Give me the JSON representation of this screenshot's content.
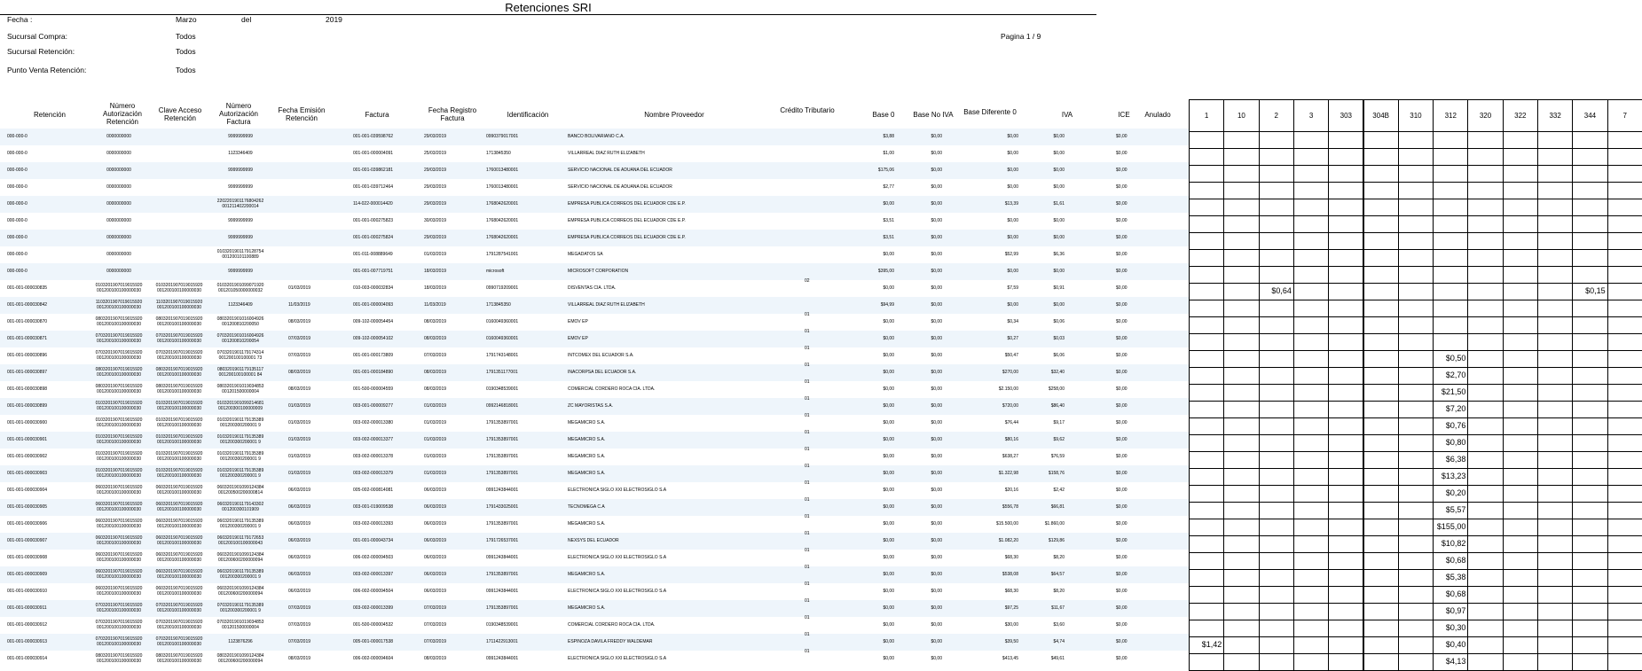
{
  "title": "Retenciones SRI",
  "page": "Pagina 1 / 9",
  "filters": [
    {
      "label": "Fecha :",
      "value": "Marzo",
      "extra1": "del",
      "extra2": "2019"
    },
    {
      "label": "Sucursal Compra:",
      "value": "Todos"
    },
    {
      "label": "Sucursal Retención:",
      "value": "Todos"
    },
    {
      "label": "Punto Venta Retención:",
      "value": "Todos"
    }
  ],
  "columns": {
    "retencion": "Retención",
    "num_aut_ret": "Número\nAutorización\nRetención",
    "clave": "Clave Acceso\nRetención",
    "num_aut_fac": "Número\nAutorización\nFactura",
    "fecha_emision": "Fecha Emisión\nRetención",
    "factura": "Factura",
    "fecha_registro": "Fecha Registro\nFactura",
    "identificacion": "Identificación",
    "proveedor": "Nombre Proveedor",
    "credito": "Crédito Tributario",
    "base0": "Base 0",
    "base_no_iva": "Base No IVA",
    "base_dif": "Base Diferente 0",
    "iva": "IVA",
    "ice": "ICE",
    "anulado": "Anulado"
  },
  "code_columns": [
    "1",
    "10",
    "2",
    "3",
    "303",
    "304B",
    "310",
    "312",
    "320",
    "322",
    "332",
    "344",
    "7"
  ],
  "rows": [
    {
      "ret": "000-000-0",
      "nar": "0000000000",
      "clave": "",
      "naf": "9999999999",
      "fe": "",
      "fac": "001-001-039598762",
      "fr": "29/03/2019",
      "id": "0990379017001",
      "prov": "BANCO BOLIVARIANO C.A.",
      "cred": "",
      "b0": "$3,88",
      "bni": "$0,00",
      "bd": "$0,00",
      "iva": "$0,00",
      "ice": "$0,00",
      "codes": {}
    },
    {
      "ret": "000-000-0",
      "nar": "0000000000",
      "clave": "",
      "naf": "1123346409",
      "fe": "",
      "fac": "001-001-000004091",
      "fr": "25/03/2019",
      "id": "1713845350",
      "prov": "VILLARREAL DIAZ RUTH ELIZABETH",
      "cred": "",
      "b0": "$1,00",
      "bni": "$0,00",
      "bd": "$0,00",
      "iva": "$0,00",
      "ice": "$0,00",
      "codes": {}
    },
    {
      "ret": "000-000-0",
      "nar": "0000000000",
      "clave": "",
      "naf": "9999999999",
      "fe": "",
      "fac": "001-001-039862181",
      "fr": "29/03/2019",
      "id": "1760013480001",
      "prov": "SERVICIO NACIONAL DE ADUANA DEL ECUADOR",
      "cred": "",
      "b0": "$175,06",
      "bni": "$0,00",
      "bd": "$0,00",
      "iva": "$0,00",
      "ice": "$0,00",
      "codes": {}
    },
    {
      "ret": "000-000-0",
      "nar": "0000000000",
      "clave": "",
      "naf": "9999999999",
      "fe": "",
      "fac": "001-001-039712464",
      "fr": "29/03/2019",
      "id": "1760013480001",
      "prov": "SERVICIO NACIONAL DE ADUANA DEL ECUADOR",
      "cred": "",
      "b0": "$2,77",
      "bni": "$0,00",
      "bd": "$0,00",
      "iva": "$0,00",
      "ice": "$0,00",
      "codes": {}
    },
    {
      "ret": "000-000-0",
      "nar": "0000000000",
      "clave": "",
      "naf": "2202201901176804262\n001211402200014",
      "fe": "",
      "fac": "114-022-000014420",
      "fr": "29/03/2019",
      "id": "1768042620001",
      "prov": "EMPRESA PUBLICA CORREOS DEL ECUADOR CDE E.P.",
      "cred": "",
      "b0": "$0,00",
      "bni": "$0,00",
      "bd": "$13,39",
      "iva": "$1,61",
      "ice": "$0,00",
      "codes": {}
    },
    {
      "ret": "000-000-0",
      "nar": "0000000000",
      "clave": "",
      "naf": "9999999999",
      "fe": "",
      "fac": "001-001-000275823",
      "fr": "30/03/2019",
      "id": "1768042620001",
      "prov": "EMPRESA PUBLICA CORREOS DEL ECUADOR CDE E.P.",
      "cred": "",
      "b0": "$3,51",
      "bni": "$0,00",
      "bd": "$0,00",
      "iva": "$0,00",
      "ice": "$0,00",
      "codes": {}
    },
    {
      "ret": "000-000-0",
      "nar": "0000000000",
      "clave": "",
      "naf": "9999999999",
      "fe": "",
      "fac": "001-001-000275824",
      "fr": "29/03/2019",
      "id": "1768042620001",
      "prov": "EMPRESA PUBLICA CORREOS DEL ECUADOR CDE E.P.",
      "cred": "",
      "b0": "$3,51",
      "bni": "$0,00",
      "bd": "$0,00",
      "iva": "$0,00",
      "ice": "$0,00",
      "codes": {}
    },
    {
      "ret": "000-000-0",
      "nar": "0000000000",
      "clave": "",
      "naf": "0103201901179128754\n001200101100889",
      "fe": "",
      "fac": "001-011-008889649",
      "fr": "01/03/2019",
      "id": "1791287541001",
      "prov": "MEGADATOS SA",
      "cred": "",
      "b0": "$0,00",
      "bni": "$0,00",
      "bd": "$52,99",
      "iva": "$6,36",
      "ice": "$0,00",
      "codes": {}
    },
    {
      "ret": "000-000-0",
      "nar": "0000000000",
      "clave": "",
      "naf": "9999999999",
      "fe": "",
      "fac": "001-001-007719751",
      "fr": "18/03/2019",
      "id": "microsoft",
      "prov": "MICROSOFT CORPORATION",
      "cred": "",
      "b0": "$395,00",
      "bni": "$0,00",
      "bd": "$0,00",
      "iva": "$0,00",
      "ice": "$0,00",
      "codes": {}
    },
    {
      "ret": "001-001-000030835",
      "nar": "0103201907019015920\n001200100100000030",
      "clave": "0103201907019015920\n001200100100000030",
      "naf": "0103201901099071920\n001201050000000032",
      "fe": "01/03/2019",
      "fac": "010-003-000032834",
      "fr": "18/03/2019",
      "id": "0990719209001",
      "prov": "DISVENTAS CIA. LTDA.",
      "cred": "02",
      "b0": "$0,00",
      "bni": "$0,00",
      "bd": "$7,59",
      "iva": "$0,91",
      "ice": "$0,00",
      "codes": {
        "2": "$0,64",
        "344": "$0,15"
      }
    },
    {
      "ret": "001-001-000030842",
      "nar": "1103201907019015920\n001200100100000030",
      "clave": "1103201907019015920\n001200100100000030",
      "naf": "1123346409",
      "fe": "11/03/2019",
      "fac": "001-001-000004093",
      "fr": "11/03/2019",
      "id": "1713845350",
      "prov": "VILLARREAL DIAZ RUTH ELIZABETH",
      "cred": "",
      "b0": "$94,99",
      "bni": "$0,00",
      "bd": "$0,00",
      "iva": "$0,00",
      "ice": "$0,00",
      "codes": {}
    },
    {
      "ret": "001-001-000030870",
      "nar": "0803201907019015920\n001200100100000030",
      "clave": "0803201907019015920\n001200100100000030",
      "naf": "0803201901016004926\n001200810200050",
      "fe": "08/03/2019",
      "fac": "009-102-000054454",
      "fr": "08/03/2019",
      "id": "0160049360001",
      "prov": "EMOV EP",
      "cred": "01",
      "b0": "$0,00",
      "bni": "$0,00",
      "bd": "$0,34",
      "iva": "$0,06",
      "ice": "$0,00",
      "codes": {}
    },
    {
      "ret": "001-001-000030871",
      "nar": "0703201907019015920\n001200100100000030",
      "clave": "0703201907019015920\n001200100100000030",
      "naf": "0703201901016004926\n001200810200054",
      "fe": "07/03/2019",
      "fac": "009-102-000054102",
      "fr": "08/03/2019",
      "id": "0160049360001",
      "prov": "EMOV EP",
      "cred": "01",
      "b0": "$0,00",
      "bni": "$0,00",
      "bd": "$0,27",
      "iva": "$0,03",
      "ice": "$0,00",
      "codes": {}
    },
    {
      "ret": "001-001-000030896",
      "nar": "0703201907019015920\n001200100100000030",
      "clave": "0703201907019015920\n001200100100000030",
      "naf": "0703201901179174314\n001200100100001 73",
      "fe": "07/03/2019",
      "fac": "001-001-000173809",
      "fr": "07/03/2019",
      "id": "1791743148001",
      "prov": "INTCOMEX DEL ECUADOR S.A.",
      "cred": "01",
      "b0": "$0,00",
      "bni": "$0,00",
      "bd": "$50,47",
      "iva": "$6,06",
      "ice": "$0,00",
      "codes": {
        "312": "$0,50"
      }
    },
    {
      "ret": "001-001-000030897",
      "nar": "0803201907019015920\n001200100100000030",
      "clave": "0803201907019015920\n001200100100000030",
      "naf": "0803201901179135117\n001200100100001 84",
      "fe": "08/03/2019",
      "fac": "001-001-000184890",
      "fr": "08/03/2019",
      "id": "1791351177001",
      "prov": "INACORPSA DEL ECUADOR S.A.",
      "cred": "01",
      "b0": "$0,00",
      "bni": "$0,00",
      "bd": "$270,00",
      "iva": "$32,40",
      "ice": "$0,00",
      "codes": {
        "312": "$2,70"
      }
    },
    {
      "ret": "001-001-000030898",
      "nar": "0803201907019015920\n001200100100000030",
      "clave": "0803201907019015920\n001200100100000030",
      "naf": "0803201901019034853\n001201500000004",
      "fe": "08/03/2019",
      "fac": "001-500-000004559",
      "fr": "08/03/2019",
      "id": "0190348539001",
      "prov": "COMERCIAL CORDERO ROCA CIA. LTDA.",
      "cred": "01",
      "b0": "$0,00",
      "bni": "$0,00",
      "bd": "$2.150,00",
      "iva": "$258,00",
      "ice": "$0,00",
      "codes": {
        "312": "$21,50"
      }
    },
    {
      "ret": "001-001-000030899",
      "nar": "0103201907019015920\n001200100100000030",
      "clave": "0103201907019015920\n001200100100000030",
      "naf": "0103201901099214681\n001200300100000009",
      "fe": "01/03/2019",
      "fac": "003-001-000009277",
      "fr": "01/03/2019",
      "id": "0992146818001",
      "prov": "ZC MAYORISTAS S.A.",
      "cred": "01",
      "b0": "$0,00",
      "bni": "$0,00",
      "bd": "$720,00",
      "iva": "$86,40",
      "ice": "$0,00",
      "codes": {
        "312": "$7,20"
      }
    },
    {
      "ret": "001-001-000030900",
      "nar": "0103201907019015920\n001200100100000030",
      "clave": "0103201907019015920\n001200100100000030",
      "naf": "0103201901179135389\n001200300200001 9",
      "fe": "01/03/2019",
      "fac": "003-002-000013380",
      "fr": "01/03/2019",
      "id": "1791353897001",
      "prov": "MEGAMICRO S.A.",
      "cred": "01",
      "b0": "$0,00",
      "bni": "$0,00",
      "bd": "$76,44",
      "iva": "$9,17",
      "ice": "$0,00",
      "codes": {
        "312": "$0,76"
      }
    },
    {
      "ret": "001-001-000030901",
      "nar": "0103201907019015920\n001200100100000030",
      "clave": "0103201907019015920\n001200100100000030",
      "naf": "0103201901179135389\n001200300200001 9",
      "fe": "01/03/2019",
      "fac": "003-002-000013377",
      "fr": "01/03/2019",
      "id": "1791353897001",
      "prov": "MEGAMICRO S.A.",
      "cred": "01",
      "b0": "$0,00",
      "bni": "$0,00",
      "bd": "$80,16",
      "iva": "$9,62",
      "ice": "$0,00",
      "codes": {
        "312": "$0,80"
      }
    },
    {
      "ret": "001-001-000030902",
      "nar": "0103201907019015920\n001200100100000030",
      "clave": "0103201907019015920\n001200100100000030",
      "naf": "0103201901179135389\n001200300200001 9",
      "fe": "01/03/2019",
      "fac": "003-002-000013378",
      "fr": "01/03/2019",
      "id": "1791353897001",
      "prov": "MEGAMICRO S.A.",
      "cred": "01",
      "b0": "$0,00",
      "bni": "$0,00",
      "bd": "$638,27",
      "iva": "$76,59",
      "ice": "$0,00",
      "codes": {
        "312": "$6,38"
      }
    },
    {
      "ret": "001-001-000030903",
      "nar": "0103201907019015920\n001200100100000030",
      "clave": "0103201907019015920\n001200100100000030",
      "naf": "0103201901179135389\n001200300200001 9",
      "fe": "01/03/2019",
      "fac": "003-002-000013379",
      "fr": "01/03/2019",
      "id": "1791353897001",
      "prov": "MEGAMICRO S.A.",
      "cred": "01",
      "b0": "$0,00",
      "bni": "$0,00",
      "bd": "$1.322,98",
      "iva": "$158,76",
      "ice": "$0,00",
      "codes": {
        "312": "$13,23"
      }
    },
    {
      "ret": "001-001-000030904",
      "nar": "0603201907019015920\n001200100100000030",
      "clave": "0603201907019015920\n001200100100000030",
      "naf": "0603201901099124384\n001200500200000814",
      "fe": "06/03/2019",
      "fac": "005-002-000814081",
      "fr": "06/03/2019",
      "id": "0991243844001",
      "prov": "ELECTRONICA SIGLO XXI ELECTROSIGLO S.A",
      "cred": "01",
      "b0": "$0,00",
      "bni": "$0,00",
      "bd": "$20,16",
      "iva": "$2,42",
      "ice": "$0,00",
      "codes": {
        "312": "$0,20"
      }
    },
    {
      "ret": "001-001-000030905",
      "nar": "0603201907019015920\n001200100100000030",
      "clave": "0603201907019015920\n001200100100000030",
      "naf": "0603201901179143302\n001200300101909",
      "fe": "06/03/2019",
      "fac": "003-001-019009538",
      "fr": "06/03/2019",
      "id": "1791433025001",
      "prov": "TECNOMEGA C.A",
      "cred": "01",
      "b0": "$0,00",
      "bni": "$0,00",
      "bd": "$556,78",
      "iva": "$66,81",
      "ice": "$0,00",
      "codes": {
        "312": "$5,57"
      }
    },
    {
      "ret": "001-001-000030906",
      "nar": "0603201907019015920\n001200100100000030",
      "clave": "0603201907019015920\n001200100100000030",
      "naf": "0603201901179135389\n001200300200001 9",
      "fe": "06/03/2019",
      "fac": "003-002-000013393",
      "fr": "06/03/2019",
      "id": "1791353897001",
      "prov": "MEGAMICRO S.A.",
      "cred": "01",
      "b0": "$0,00",
      "bni": "$0,00",
      "bd": "$15.500,00",
      "iva": "$1.860,00",
      "ice": "$0,00",
      "codes": {
        "312": "$155,00"
      }
    },
    {
      "ret": "001-001-000030907",
      "nar": "0603201907019015920\n001200100100000030",
      "clave": "0603201907019015920\n001200100100000030",
      "naf": "0603201901179172653\n001200100100000043",
      "fe": "06/03/2019",
      "fac": "001-001-000043734",
      "fr": "06/03/2019",
      "id": "1791726537001",
      "prov": "NEXSYS DEL ECUADOR",
      "cred": "01",
      "b0": "$0,00",
      "bni": "$0,00",
      "bd": "$1.082,20",
      "iva": "$129,86",
      "ice": "$0,00",
      "codes": {
        "312": "$10,82"
      }
    },
    {
      "ret": "001-001-000030908",
      "nar": "0603201907019015920\n001200100100000030",
      "clave": "0603201907019015920\n001200100100000030",
      "naf": "0603201901099124384\n001200600200000094",
      "fe": "06/03/2019",
      "fac": "006-002-000094503",
      "fr": "06/03/2019",
      "id": "0991243844001",
      "prov": "ELECTRONICA SIGLO XXI ELECTROSIGLO S.A",
      "cred": "01",
      "b0": "$0,00",
      "bni": "$0,00",
      "bd": "$68,30",
      "iva": "$8,20",
      "ice": "$0,00",
      "codes": {
        "312": "$0,68"
      }
    },
    {
      "ret": "001-001-000030909",
      "nar": "0603201907019015920\n001200100100000030",
      "clave": "0603201907019015920\n001200100100000030",
      "naf": "0603201901179135389\n001200300200001 9",
      "fe": "06/03/2019",
      "fac": "003-002-000013397",
      "fr": "06/03/2019",
      "id": "1791353897001",
      "prov": "MEGAMICRO S.A.",
      "cred": "01",
      "b0": "$0,00",
      "bni": "$0,00",
      "bd": "$538,08",
      "iva": "$64,57",
      "ice": "$0,00",
      "codes": {
        "312": "$5,38"
      }
    },
    {
      "ret": "001-001-000030910",
      "nar": "0603201907019015920\n001200100100000030",
      "clave": "0603201907019015920\n001200100100000030",
      "naf": "0603201901099124384\n001200600200000094",
      "fe": "06/03/2019",
      "fac": "006-002-000094504",
      "fr": "06/03/2019",
      "id": "0991243844001",
      "prov": "ELECTRONICA SIGLO XXI ELECTROSIGLO S.A",
      "cred": "01",
      "b0": "$0,00",
      "bni": "$0,00",
      "bd": "$68,30",
      "iva": "$8,20",
      "ice": "$0,00",
      "codes": {
        "312": "$0,68"
      }
    },
    {
      "ret": "001-001-000030911",
      "nar": "0703201907019015920\n001200100100000030",
      "clave": "0703201907019015920\n001200100100000030",
      "naf": "0703201901179135389\n001200300200001 9",
      "fe": "07/03/2019",
      "fac": "003-002-000013399",
      "fr": "07/03/2019",
      "id": "1791353897001",
      "prov": "MEGAMICRO S.A.",
      "cred": "01",
      "b0": "$0,00",
      "bni": "$0,00",
      "bd": "$97,25",
      "iva": "$11,67",
      "ice": "$0,00",
      "codes": {
        "312": "$0,97"
      }
    },
    {
      "ret": "001-001-000030912",
      "nar": "0703201907019015920\n001200100100000030",
      "clave": "0703201907019015920\n001200100100000030",
      "naf": "0703201901019034853\n001201500000004",
      "fe": "07/03/2019",
      "fac": "001-500-000004532",
      "fr": "07/03/2019",
      "id": "0190348539001",
      "prov": "COMERCIAL CORDERO ROCA CIA. LTDA.",
      "cred": "01",
      "b0": "$0,00",
      "bni": "$0,00",
      "bd": "$30,00",
      "iva": "$3,60",
      "ice": "$0,00",
      "codes": {
        "312": "$0,30"
      }
    },
    {
      "ret": "001-001-000030913",
      "nar": "0703201907019015920\n001200100100000030",
      "clave": "0703201907019015920\n001200100100000030",
      "naf": "1123876296",
      "fe": "07/03/2019",
      "fac": "005-001-000017538",
      "fr": "07/03/2019",
      "id": "1711422913001",
      "prov": "ESPINOZA DAVILA FREDDY WALDEMAR",
      "cred": "01",
      "b0": "$0,00",
      "bni": "$0,00",
      "bd": "$39,50",
      "iva": "$4,74",
      "ice": "$0,00",
      "codes": {
        "1": "$1,42",
        "312": "$0,40"
      }
    },
    {
      "ret": "001-001-000030914",
      "nar": "0803201907019015920\n001200100100000030",
      "clave": "0803201907019015920\n001200100100000030",
      "naf": "0803201901099124384\n001200600200000094",
      "fe": "08/03/2019",
      "fac": "006-002-000094604",
      "fr": "08/03/2019",
      "id": "0991243844001",
      "prov": "ELECTRONICA SIGLO XXI ELECTROSIGLO S.A",
      "cred": "01",
      "b0": "$0,00",
      "bni": "$0,00",
      "bd": "$413,45",
      "iva": "$49,61",
      "ice": "$0,00",
      "codes": {
        "312": "$4,13"
      }
    }
  ]
}
